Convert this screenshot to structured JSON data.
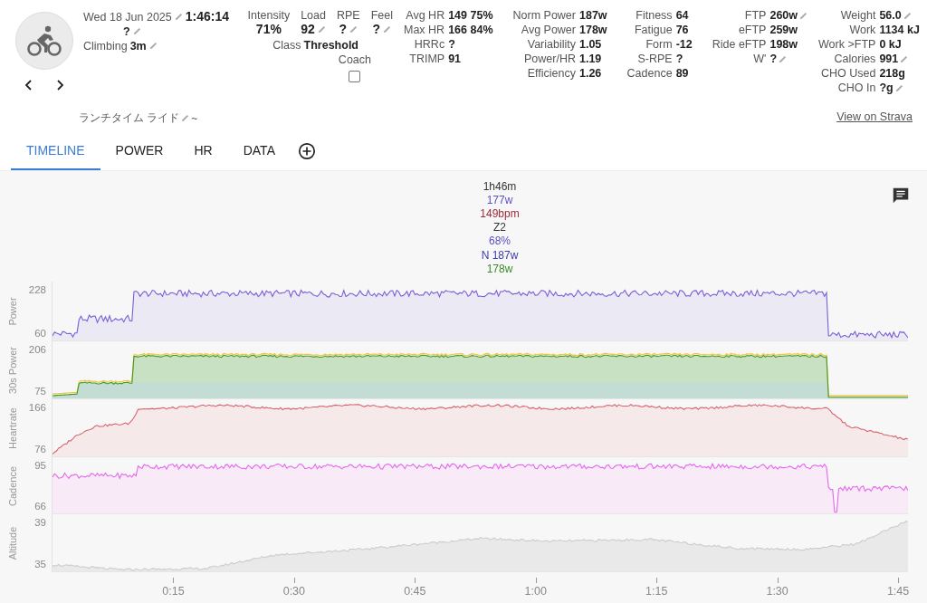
{
  "activity": {
    "date": "Wed 18 Jun 2025",
    "duration": "1:46:14",
    "time_of_day": "?",
    "climbing_label": "Climbing",
    "climbing": "3m",
    "title": "ランチタイム ライド",
    "title_suffix": "~"
  },
  "effort": [
    {
      "label": "Intensity",
      "value": "71%",
      "editable": false
    },
    {
      "label": "Load",
      "value": "92",
      "editable": true
    },
    {
      "label": "RPE",
      "value": "?",
      "editable": true
    },
    {
      "label": "Feel",
      "value": "?",
      "editable": true
    }
  ],
  "class": {
    "label": "Class",
    "value": "Threshold"
  },
  "coach": {
    "label": "Coach",
    "checked": false
  },
  "stat_groups": [
    [
      {
        "label": "Avg HR",
        "value": "149 75%",
        "editable": false
      },
      {
        "label": "Max HR",
        "value": "166 84%",
        "editable": false
      },
      {
        "label": "HRRc",
        "value": "?",
        "editable": false
      },
      {
        "label": "TRIMP",
        "value": "91",
        "editable": false
      }
    ],
    [
      {
        "label": "Norm Power",
        "value": "187w",
        "editable": false
      },
      {
        "label": "Avg Power",
        "value": "178w",
        "editable": false
      },
      {
        "label": "Variability",
        "value": "1.05",
        "editable": false
      },
      {
        "label": "Power/HR",
        "value": "1.19",
        "editable": false
      },
      {
        "label": "Efficiency",
        "value": "1.26",
        "editable": false
      }
    ],
    [
      {
        "label": "Fitness",
        "value": "64",
        "editable": false
      },
      {
        "label": "Fatigue",
        "value": "76",
        "editable": false
      },
      {
        "label": "Form",
        "value": "-12",
        "editable": false
      },
      {
        "label": "S-RPE",
        "value": "?",
        "editable": false
      },
      {
        "label": "Cadence",
        "value": "89",
        "editable": false
      }
    ],
    [
      {
        "label": "FTP",
        "value": "260w",
        "editable": true
      },
      {
        "label": "eFTP",
        "value": "259w",
        "editable": false
      },
      {
        "label": "Ride eFTP",
        "value": "198w",
        "editable": false
      },
      {
        "label": "W'",
        "value": "?",
        "editable": true
      }
    ],
    [
      {
        "label": "Weight",
        "value": "56.0",
        "editable": true
      },
      {
        "label": "Work",
        "value": "1134 kJ",
        "editable": false
      },
      {
        "label": "Work >FTP",
        "value": "0 kJ",
        "editable": false
      },
      {
        "label": "Calories",
        "value": "991",
        "editable": true
      },
      {
        "label": "CHO Used",
        "value": "218g",
        "editable": false
      },
      {
        "label": "CHO In",
        "value": "?g",
        "editable": true
      }
    ]
  ],
  "strava_link": "View on Strava",
  "tabs": [
    {
      "label": "TIMELINE",
      "selected": true
    },
    {
      "label": "POWER",
      "selected": false
    },
    {
      "label": "HR",
      "selected": false
    },
    {
      "label": "DATA",
      "selected": false
    }
  ],
  "summary": [
    {
      "text": "1h46m",
      "color": "#333333"
    },
    {
      "text": "177w",
      "color": "#5b4fc4"
    },
    {
      "text": "149bpm",
      "color": "#9c2a3c"
    },
    {
      "text": "Z2",
      "color": "#333333"
    },
    {
      "text": "68%",
      "color": "#5b4fc4"
    },
    {
      "text": "N 187w",
      "color": "#3a3aa8"
    },
    {
      "text": "178w",
      "color": "#3a8a2a"
    }
  ],
  "panels": [
    {
      "kind": "power",
      "name": "Power",
      "ticks": [
        "228",
        "60"
      ]
    },
    {
      "kind": "power30",
      "name": "30s Power",
      "ticks": [
        "206",
        "75"
      ]
    },
    {
      "kind": "hr",
      "name": "Heartrate",
      "ticks": [
        "166",
        "76"
      ]
    },
    {
      "kind": "cadence",
      "name": "Cadence",
      "ticks": [
        "95",
        "66"
      ]
    },
    {
      "kind": "altitude",
      "name": "Altitude",
      "ticks": [
        "39",
        "35"
      ]
    }
  ],
  "xticks": [
    "0:15",
    "0:30",
    "0:45",
    "1:00",
    "1:15",
    "1:30",
    "1:45"
  ]
}
